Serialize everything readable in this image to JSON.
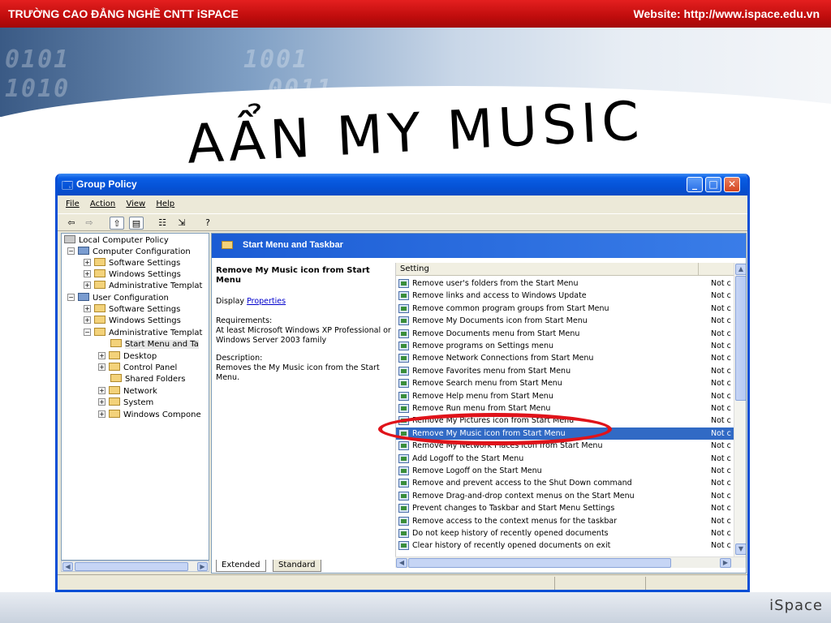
{
  "header": {
    "school": "TRƯỜNG CAO ĐẲNG NGHỀ CNTT iSPACE",
    "website": "Website: http://www.ispace.edu.vn"
  },
  "slide_title": "AẨN MY MUSIC",
  "window": {
    "title": "Group Policy",
    "menu": [
      "File",
      "Action",
      "View",
      "Help"
    ],
    "tree": [
      {
        "label": "Local Computer Policy"
      },
      {
        "label": "Computer Configuration"
      },
      {
        "label": "Software Settings"
      },
      {
        "label": "Windows Settings"
      },
      {
        "label": "Administrative Templat"
      },
      {
        "label": "User Configuration"
      },
      {
        "label": "Software Settings"
      },
      {
        "label": "Windows Settings"
      },
      {
        "label": "Administrative Templat"
      },
      {
        "label": "Start Menu and Ta"
      },
      {
        "label": "Desktop"
      },
      {
        "label": "Control Panel"
      },
      {
        "label": "Shared Folders"
      },
      {
        "label": "Network"
      },
      {
        "label": "System"
      },
      {
        "label": "Windows Compone"
      }
    ],
    "pane_header": "Start Menu and Taskbar",
    "description": {
      "title": "Remove My Music icon from Start Menu",
      "display_prefix": "Display",
      "display_link": "Properties",
      "req_label": "Requirements:",
      "req_text": "At least Microsoft Windows XP Professional or Windows Server 2003 family",
      "desc_label": "Description:",
      "desc_text": "Removes the My Music icon from the Start Menu."
    },
    "list_header": "Setting",
    "settings": [
      {
        "setting": "Remove user's folders from the Start Menu",
        "state": "Not c"
      },
      {
        "setting": "Remove links and access to Windows Update",
        "state": "Not c"
      },
      {
        "setting": "Remove common program groups from Start Menu",
        "state": "Not c"
      },
      {
        "setting": "Remove My Documents icon from Start Menu",
        "state": "Not c"
      },
      {
        "setting": "Remove Documents menu from Start Menu",
        "state": "Not c"
      },
      {
        "setting": "Remove programs on Settings menu",
        "state": "Not c"
      },
      {
        "setting": "Remove Network Connections from Start Menu",
        "state": "Not c"
      },
      {
        "setting": "Remove Favorites menu from Start Menu",
        "state": "Not c"
      },
      {
        "setting": "Remove Search menu from Start Menu",
        "state": "Not c"
      },
      {
        "setting": "Remove Help menu from Start Menu",
        "state": "Not c"
      },
      {
        "setting": "Remove Run menu from Start Menu",
        "state": "Not c"
      },
      {
        "setting": "Remove My Pictures icon from Start Menu",
        "state": "Not c"
      },
      {
        "setting": "Remove My Music icon from Start Menu",
        "state": "Not c",
        "selected": true
      },
      {
        "setting": "Remove My Network Places icon from Start Menu",
        "state": "Not c"
      },
      {
        "setting": "Add Logoff to the Start Menu",
        "state": "Not c"
      },
      {
        "setting": "Remove Logoff on the Start Menu",
        "state": "Not c"
      },
      {
        "setting": "Remove and prevent access to the Shut Down command",
        "state": "Not c"
      },
      {
        "setting": "Remove Drag-and-drop context menus on the Start Menu",
        "state": "Not c"
      },
      {
        "setting": "Prevent changes to Taskbar and Start Menu Settings",
        "state": "Not c"
      },
      {
        "setting": "Remove access to the context menus for the taskbar",
        "state": "Not c"
      },
      {
        "setting": "Do not keep history of recently opened documents",
        "state": "Not c"
      },
      {
        "setting": "Clear history of recently opened documents on exit",
        "state": "Not c"
      }
    ],
    "tabs": [
      "Extended",
      "Standard"
    ]
  },
  "footer": {
    "brand": "iSpace"
  },
  "icons": {
    "app": "group-policy-icon",
    "back": "back-arrow-icon",
    "forward": "forward-arrow-icon",
    "up": "up-folder-icon",
    "show_hide_tree": "tree-toggle-icon",
    "properties": "properties-icon",
    "export": "export-list-icon",
    "help": "help-icon"
  },
  "colors": {
    "header_red": "#c00d0d",
    "selection_blue": "#316ac5",
    "xp_titlebar": "#0552d6",
    "annotation_red": "#e0131a"
  }
}
